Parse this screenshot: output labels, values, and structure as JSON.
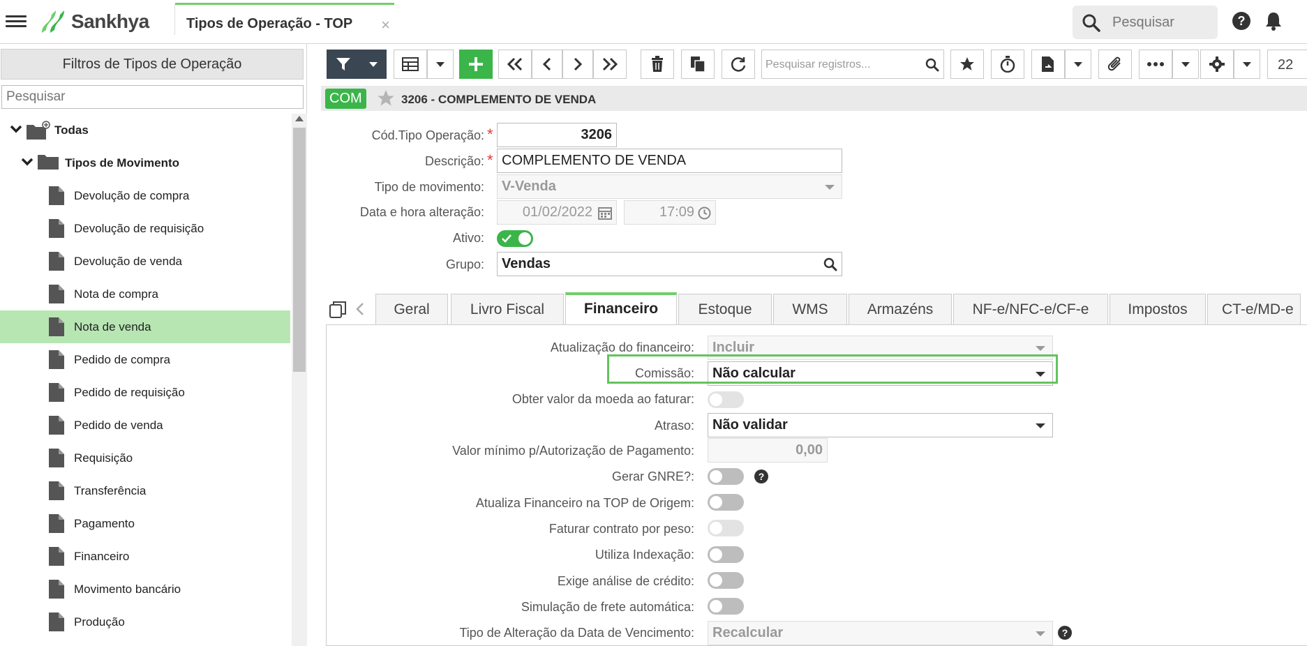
{
  "header": {
    "app_name": "Sankhya",
    "active_tab_title": "Tipos de Operação - TOP",
    "close_glyph": "×",
    "search_placeholder": "Pesquisar",
    "icons": [
      "menu-icon",
      "sankhya-logo-icon",
      "search-icon",
      "help-icon",
      "bell-icon"
    ]
  },
  "left_panel": {
    "title": "Filtros de Tipos de Operação",
    "search_placeholder": "Pesquisar",
    "root_label": "Todas",
    "group_label": "Tipos de Movimento",
    "items": [
      {
        "label": "Devolução de compra",
        "selected": false
      },
      {
        "label": "Devolução de requisição",
        "selected": false
      },
      {
        "label": "Devolução de venda",
        "selected": false
      },
      {
        "label": "Nota de compra",
        "selected": false
      },
      {
        "label": "Nota de venda",
        "selected": true
      },
      {
        "label": "Pedido de compra",
        "selected": false
      },
      {
        "label": "Pedido de requisição",
        "selected": false
      },
      {
        "label": "Pedido de venda",
        "selected": false
      },
      {
        "label": "Requisição",
        "selected": false
      },
      {
        "label": "Transferência",
        "selected": false
      },
      {
        "label": "Pagamento",
        "selected": false
      },
      {
        "label": "Financeiro",
        "selected": false
      },
      {
        "label": "Movimento bancário",
        "selected": false
      },
      {
        "label": "Produção",
        "selected": false
      }
    ]
  },
  "toolbar": {
    "search_placeholder": "Pesquisar registros...",
    "page_number": "22",
    "icons": [
      "filter-icon",
      "grid-icon",
      "plus-icon",
      "first-icon",
      "prev-icon",
      "next-icon",
      "last-icon",
      "trash-icon",
      "copy-icon",
      "refresh-icon",
      "star-icon",
      "timer-icon",
      "export-icon",
      "attach-icon",
      "more-icon",
      "gear-icon"
    ]
  },
  "record": {
    "badge": "COM",
    "title": "3206 - COMPLEMENTO DE VENDA"
  },
  "form": {
    "cod_label": "Cód.Tipo Operação:",
    "cod_value": "3206",
    "desc_label": "Descrição:",
    "desc_value": "COMPLEMENTO DE VENDA",
    "tipo_mov_label": "Tipo de movimento:",
    "tipo_mov_value": "V-Venda",
    "data_label": "Data e hora alteração:",
    "date_value": "01/02/2022",
    "time_value": "17:09",
    "ativo_label": "Ativo:",
    "ativo_on": true,
    "grupo_label": "Grupo:",
    "grupo_value": "Vendas"
  },
  "tabs": [
    "Geral",
    "Livro Fiscal",
    "Financeiro",
    "Estoque",
    "WMS",
    "Armazéns",
    "NF-e/NFC-e/CF-e",
    "Impostos",
    "CT-e/MD-e"
  ],
  "active_tab": "Financeiro",
  "financeiro": {
    "atualizacao_label": "Atualização do financeiro:",
    "atualizacao_value": "Incluir",
    "comissao_label": "Comissão:",
    "comissao_value": "Não calcular",
    "obter_moeda_label": "Obter valor da moeda ao faturar:",
    "atraso_label": "Atraso:",
    "atraso_value": "Não validar",
    "valor_min_label": "Valor mínimo p/Autorização de Pagamento:",
    "valor_min_value": "0,00",
    "gnre_label": "Gerar GNRE?:",
    "atualiza_origem_label": "Atualiza Financeiro na TOP de Origem:",
    "faturar_peso_label": "Faturar contrato por peso:",
    "indexacao_label": "Utiliza Indexação:",
    "credito_label": "Exige análise de crédito:",
    "frete_label": "Simulação de frete automática:",
    "vencimento_label": "Tipo de Alteração da Data de Vencimento:",
    "vencimento_value": "Recalcular"
  },
  "colors": {
    "accent_green": "#3bb54a",
    "selected_row": "#b7e6b3",
    "highlight_border": "#62c45d",
    "dark_button": "#3a4652"
  }
}
